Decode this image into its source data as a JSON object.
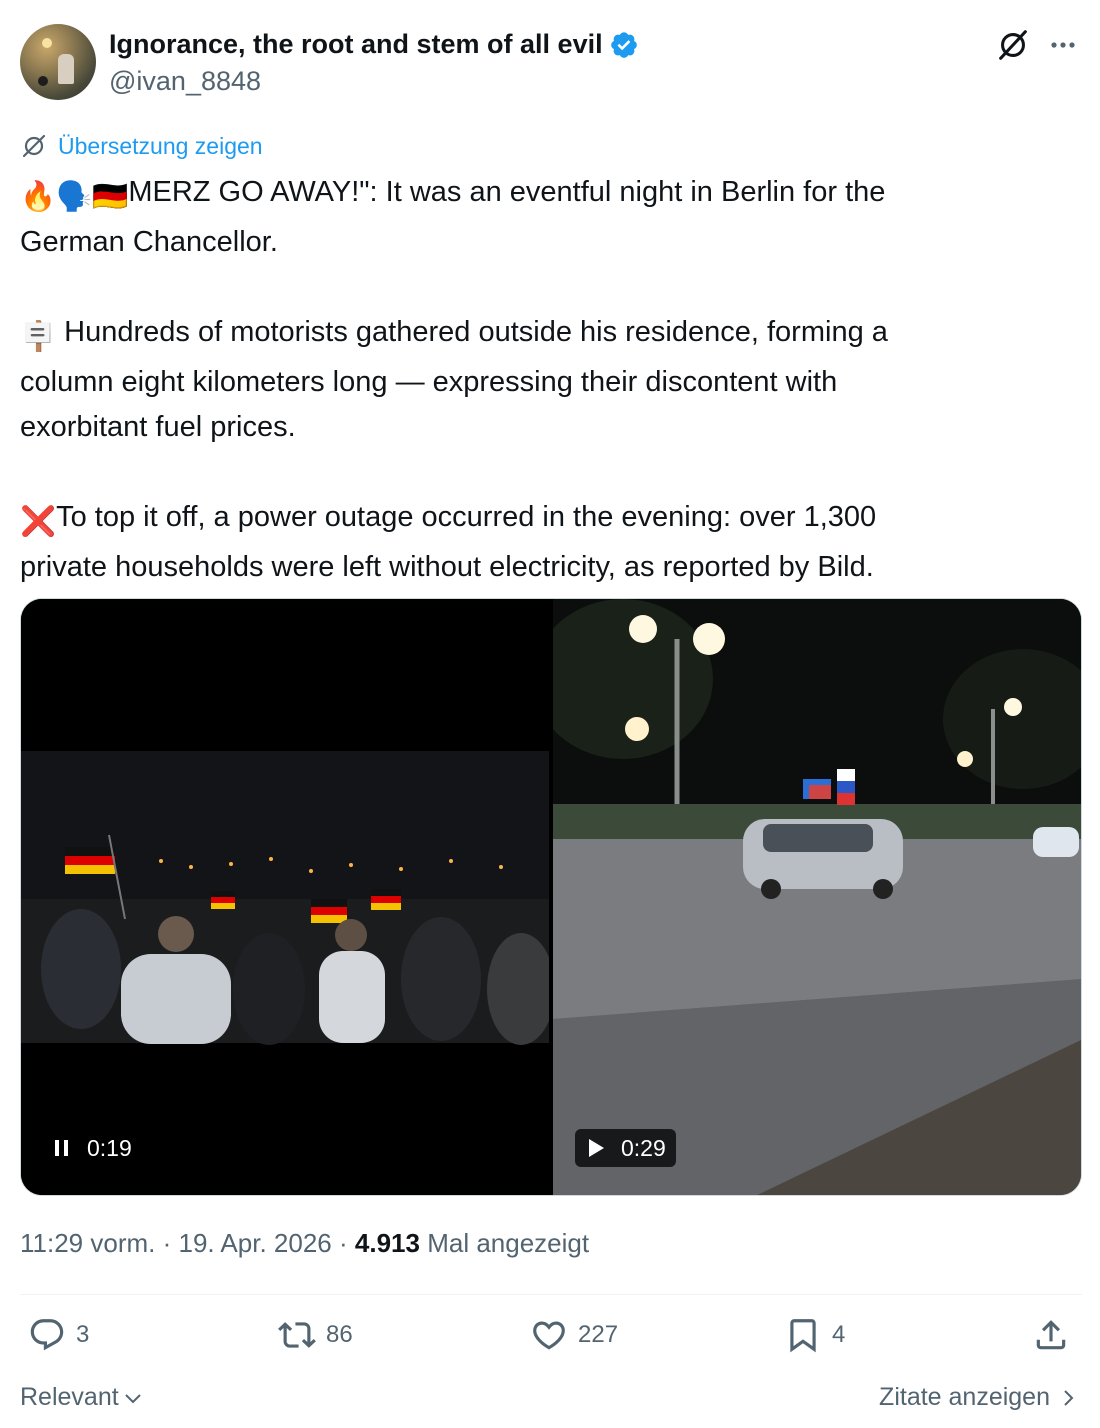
{
  "author": {
    "display_name": "Ignorance, the root and stem of all evil",
    "handle": "@ivan_8848",
    "verified": true
  },
  "translate": {
    "label": "Übersetzung zeigen"
  },
  "tweet": {
    "line1": "MERZ GO AWAY!\": It was an eventful night in Berlin for the",
    "line2": "German Chancellor.",
    "line3": "Hundreds of motorists gathered outside his residence, forming a",
    "line4": "column eight kilometers long — expressing their discontent with",
    "line5": "exorbitant fuel prices.",
    "line6": "To top it off, a power outage occurred in the evening: over 1,300",
    "line7": "private households were left without electricity, as reported by Bild.",
    "emojis": [
      "🔥",
      "🗣️",
      "🇩🇪",
      "🪧",
      "❌"
    ]
  },
  "media": {
    "video1": {
      "duration": "0:19",
      "state": "playing"
    },
    "video2": {
      "duration": "0:29",
      "state": "paused"
    }
  },
  "meta": {
    "time": "11:29 vorm.",
    "separator": "·",
    "date": "19. Apr. 2026",
    "views": "4.913",
    "views_label": "Mal angezeigt"
  },
  "actions": {
    "replies": "3",
    "reposts": "86",
    "likes": "227",
    "bookmarks": "4"
  },
  "footer": {
    "sort_label": "Relevant",
    "quotes_label": "Zitate anzeigen"
  },
  "colors": {
    "accent": "#1d9bf0",
    "text": "#0f1419",
    "muted": "#536471",
    "divider": "#eff3f4"
  }
}
